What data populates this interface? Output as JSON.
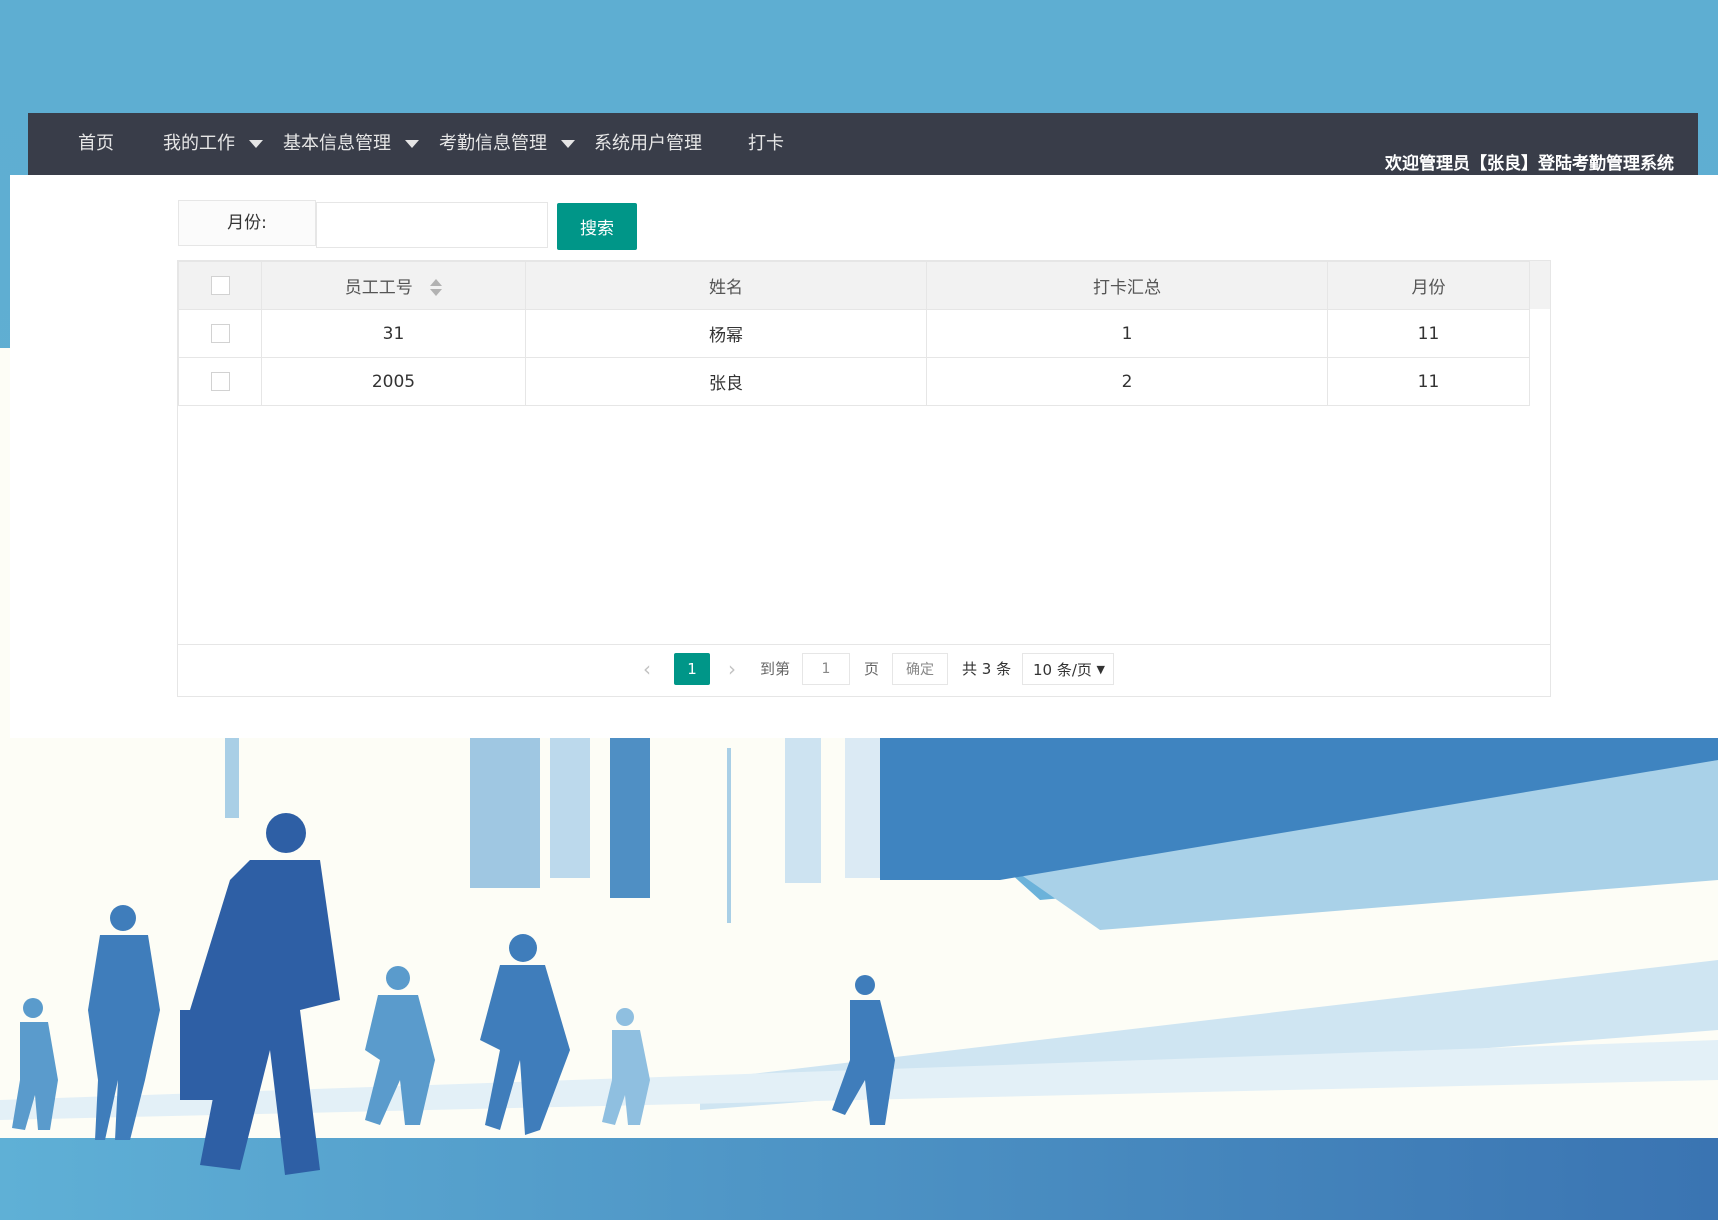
{
  "colors": {
    "accent": "#009688",
    "nav_bg": "#393d49",
    "sky": "#5eaed2",
    "figure_blue": "#2e5fa5"
  },
  "nav": {
    "items": [
      {
        "label": "首页",
        "dropdown": false
      },
      {
        "label": "我的工作",
        "dropdown": true
      },
      {
        "label": "基本信息管理",
        "dropdown": true
      },
      {
        "label": "考勤信息管理",
        "dropdown": true
      },
      {
        "label": "系统用户管理",
        "dropdown": false
      },
      {
        "label": "打卡",
        "dropdown": false
      }
    ],
    "welcome": "欢迎管理员【张良】登陆考勤管理系统"
  },
  "search": {
    "label": "月份:",
    "value": "",
    "button": "搜索"
  },
  "table": {
    "headers": [
      "员工工号",
      "姓名",
      "打卡汇总",
      "月份"
    ],
    "rows": [
      {
        "id": "31",
        "name": "杨幂",
        "total": "1",
        "month": "11"
      },
      {
        "id": "2005",
        "name": "张良",
        "total": "2",
        "month": "11"
      }
    ]
  },
  "pager": {
    "current": "1",
    "goto_label": "到第",
    "goto_value": "1",
    "page_label": "页",
    "confirm": "确定",
    "total": "共 3 条",
    "page_size": "10 条/页"
  }
}
